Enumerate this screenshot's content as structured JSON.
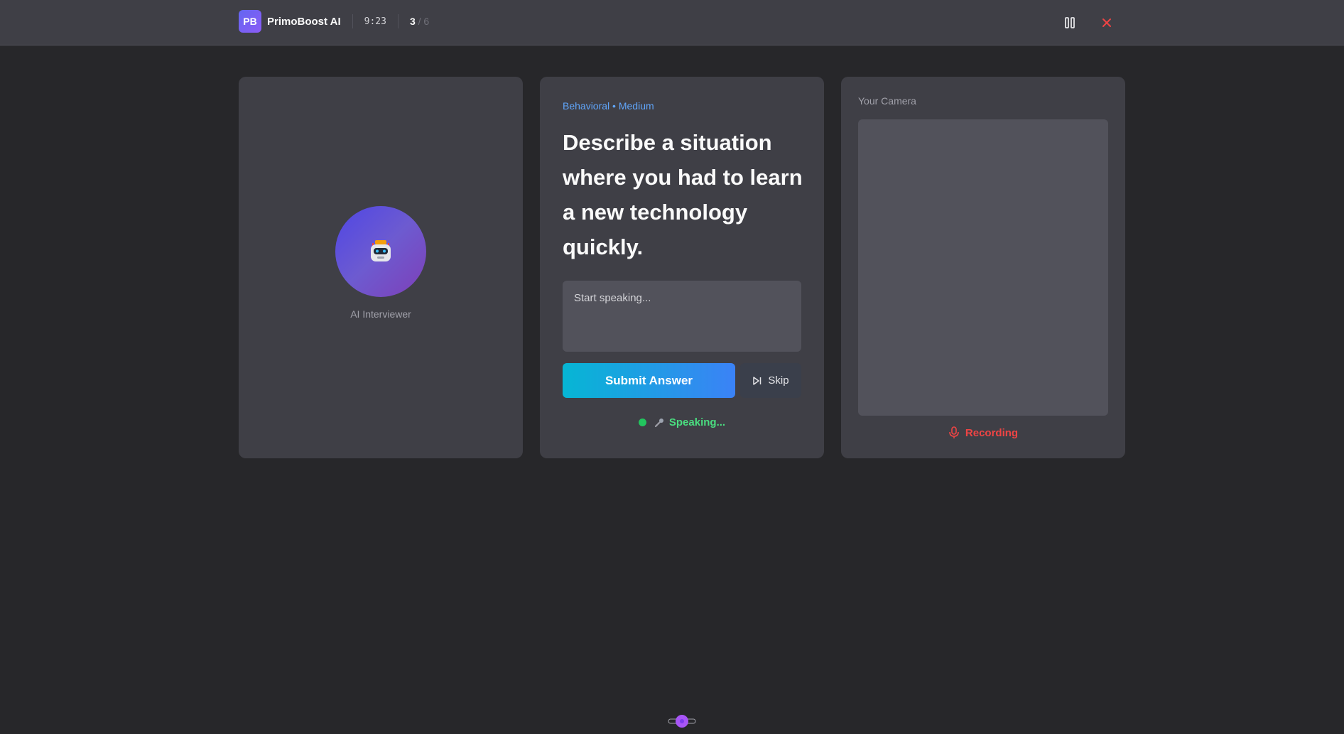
{
  "header": {
    "logo_text": "PB",
    "app_name": "PrimoBoost AI",
    "timer": "9:23",
    "question_current": "3",
    "question_total": "/ 6",
    "icons": {
      "pause": "pause-icon",
      "close": "close-icon"
    }
  },
  "interviewer": {
    "label": "AI Interviewer",
    "avatar_icon": "robot-icon"
  },
  "question": {
    "category": "Behavioral",
    "separator": "•",
    "difficulty": "Medium",
    "text": "Describe a situation where you had to learn a new technology quickly.",
    "answer_placeholder": "Start speaking...",
    "answer_value": "",
    "submit_label": "Submit Answer",
    "skip_label": "Skip",
    "status_text": "Speaking..."
  },
  "camera": {
    "label": "Your Camera",
    "recording_label": "Recording"
  },
  "colors": {
    "accent_gradient_start": "#06b6d4",
    "accent_gradient_end": "#3b82f6",
    "recording": "#ef4444",
    "speaking": "#4ade80",
    "meta": "#60a5fa"
  }
}
